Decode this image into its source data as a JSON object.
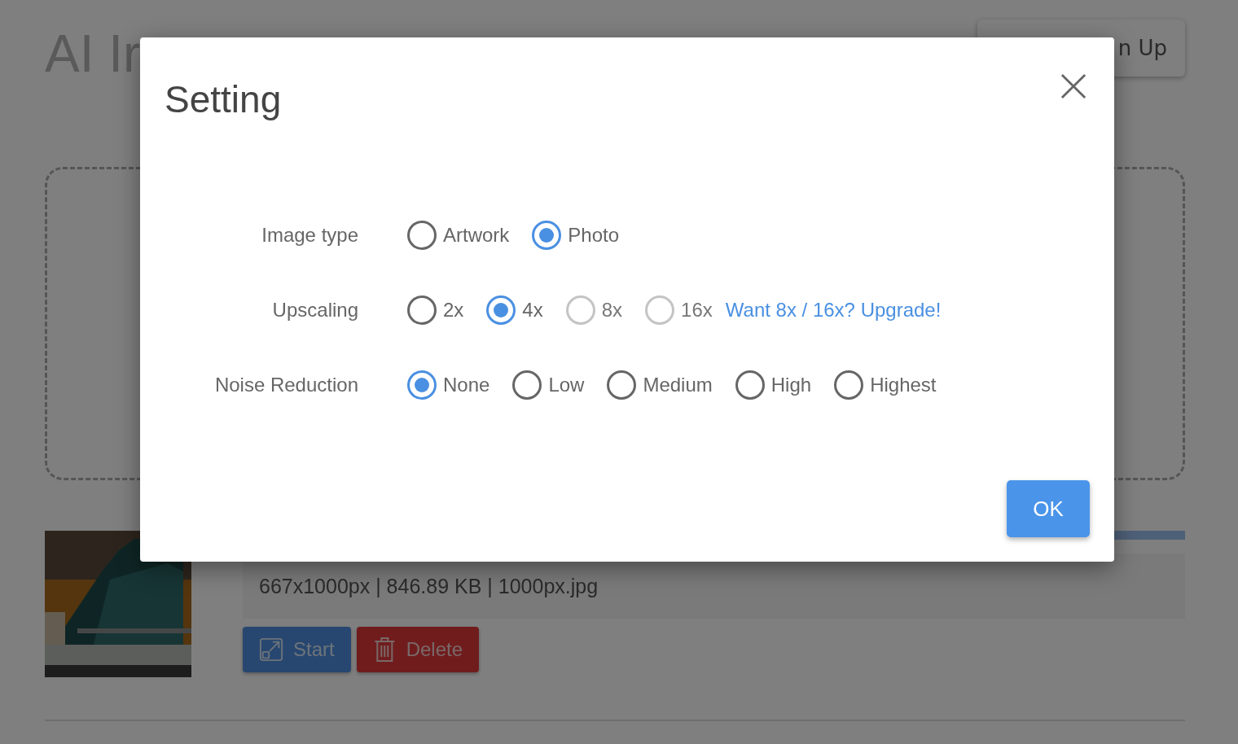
{
  "page": {
    "title": "AI Ir",
    "account_button": "n Up"
  },
  "file": {
    "progress": {
      "level": 1
    },
    "info": "667x1000px | 846.89 KB | 1000px.jpg",
    "buttons": [
      {
        "label": "Start",
        "kind": "start"
      },
      {
        "label": "Delete",
        "kind": "delete"
      }
    ]
  },
  "dialog": {
    "title": "Setting",
    "groups": [
      {
        "label": "Image type",
        "options": [
          {
            "label": "Artwork",
            "selected": false,
            "disabled": false
          },
          {
            "label": "Photo",
            "selected": true,
            "disabled": false
          }
        ]
      },
      {
        "label": "Upscaling",
        "options": [
          {
            "label": "2x",
            "selected": false,
            "disabled": false
          },
          {
            "label": "4x",
            "selected": true,
            "disabled": false
          },
          {
            "label": "8x",
            "selected": false,
            "disabled": true
          },
          {
            "label": "16x",
            "selected": false,
            "disabled": true
          }
        ],
        "link": "Want 8x / 16x? Upgrade!"
      },
      {
        "label": "Noise Reduction",
        "options": [
          {
            "label": "None",
            "selected": true,
            "disabled": false
          },
          {
            "label": "Low",
            "selected": false,
            "disabled": false
          },
          {
            "label": "Medium",
            "selected": false,
            "disabled": false
          },
          {
            "label": "High",
            "selected": false,
            "disabled": false
          },
          {
            "label": "Highest",
            "selected": false,
            "disabled": false
          }
        ]
      }
    ],
    "ok": "OK"
  }
}
